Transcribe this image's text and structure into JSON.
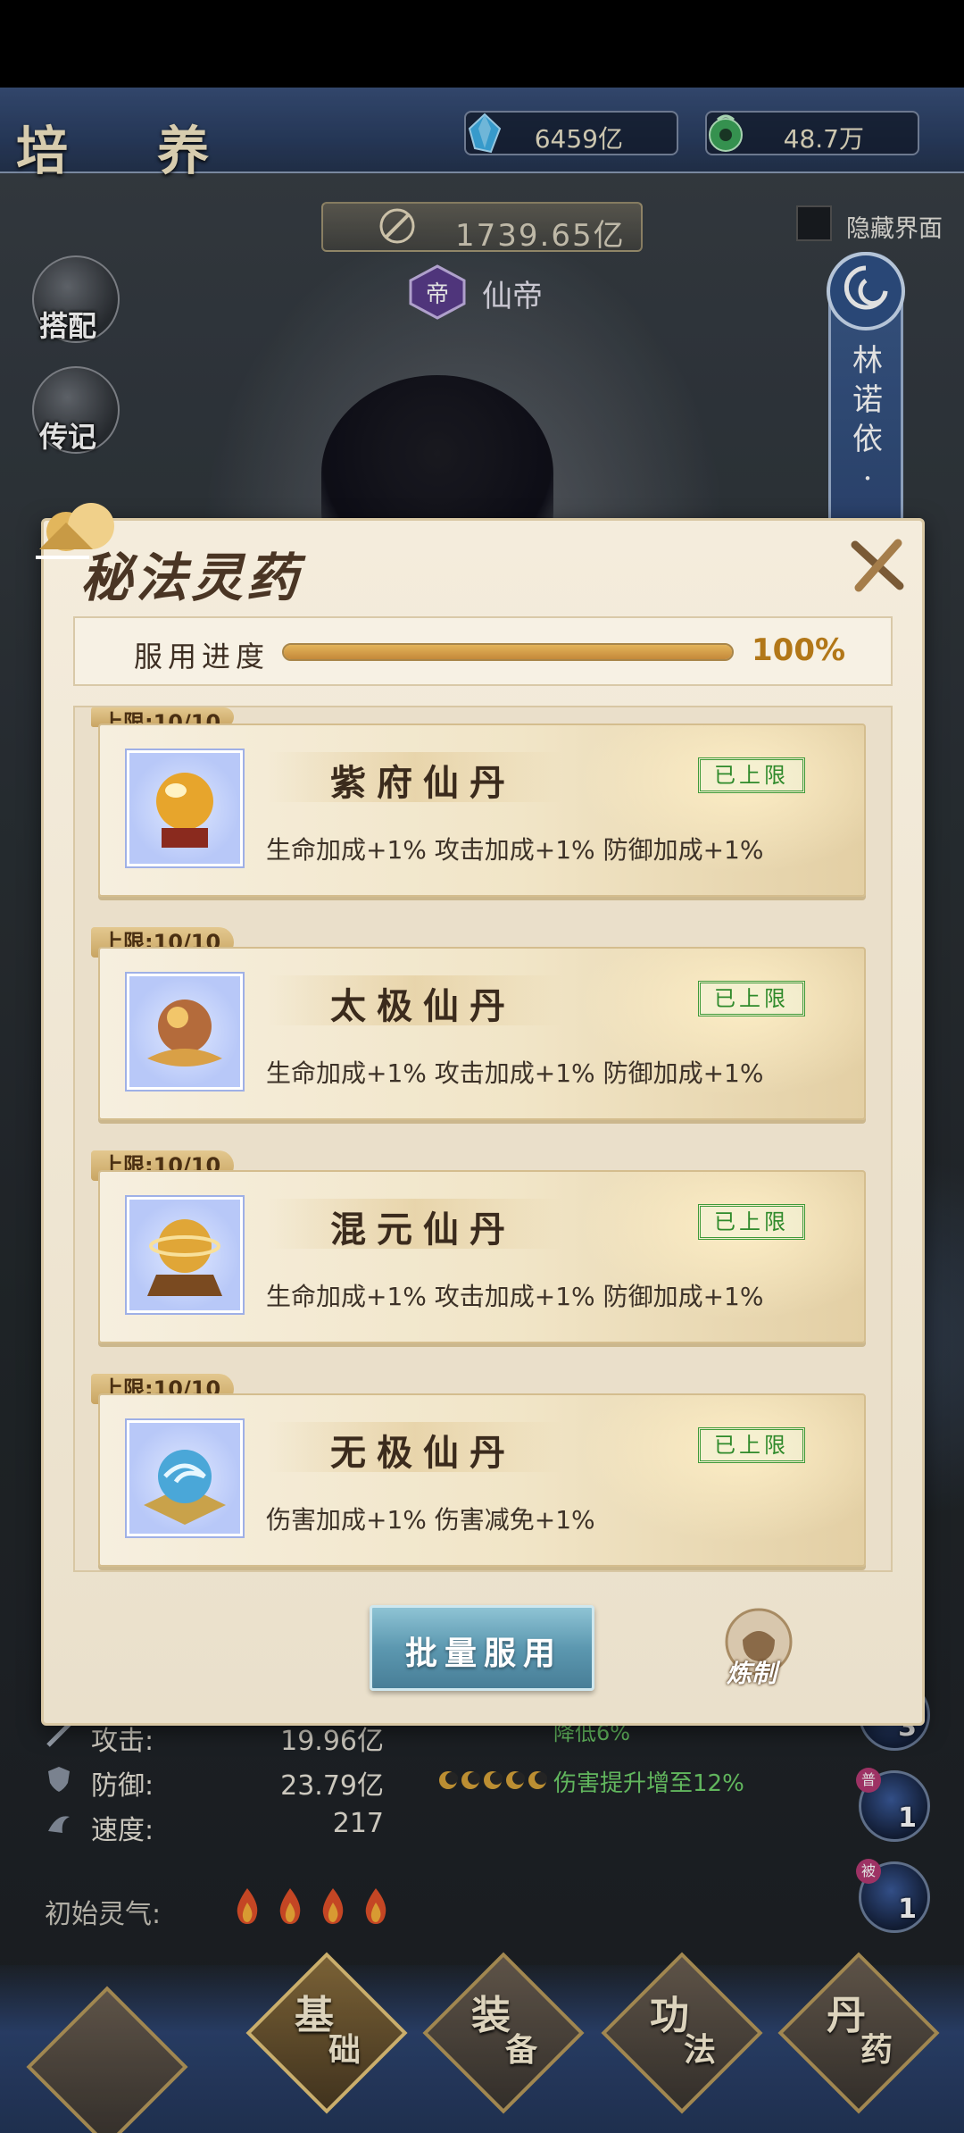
{
  "header": {
    "title": "培 养",
    "gem_amount": "6459亿",
    "coin_amount": "48.7万",
    "combat_power": "1739.65亿",
    "rank": "仙帝",
    "rank_badge": "帝",
    "hide_ui_label": "隐藏界面"
  },
  "side_menu": {
    "outfit": "搭配",
    "legend": "传记"
  },
  "character": {
    "name": "林诺依·"
  },
  "stats": {
    "attack_label": "攻击:",
    "attack_value": "19.96亿",
    "defense_label": "防御:",
    "defense_value": "23.79亿",
    "speed_label": "速度:",
    "speed_value": "217",
    "spirit_label": "初始灵气:",
    "buff_text": "伤害提升增至12%",
    "buff_text2": "降低6%"
  },
  "skills": [
    {
      "count": "3",
      "tag": ""
    },
    {
      "count": "1",
      "tag": "普"
    },
    {
      "count": "1",
      "tag": "被"
    }
  ],
  "nav": [
    {
      "top": "基",
      "bottom": "础"
    },
    {
      "top": "装",
      "bottom": "备"
    },
    {
      "top": "功",
      "bottom": "法"
    },
    {
      "top": "丹",
      "bottom": "药"
    }
  ],
  "modal": {
    "title": "秘法灵药",
    "progress_label": "服用进度",
    "progress_percent": "100%",
    "progress_value": 1.0,
    "items": [
      {
        "cap": "上限:10/10",
        "name": "紫府仙丹",
        "status": "已上限",
        "effect": "生命加成+1% 攻击加成+1% 防御加成+1%",
        "orb_color": "#e7a52c"
      },
      {
        "cap": "上限:10/10",
        "name": "太极仙丹",
        "status": "已上限",
        "effect": "生命加成+1% 攻击加成+1% 防御加成+1%",
        "orb_color": "#b46b3b"
      },
      {
        "cap": "上限:10/10",
        "name": "混元仙丹",
        "status": "已上限",
        "effect": "生命加成+1% 攻击加成+1% 防御加成+1%",
        "orb_color": "#e0a637"
      },
      {
        "cap": "上限:10/10",
        "name": "无极仙丹",
        "status": "已上限",
        "effect": "伤害加成+1% 伤害减免+1%",
        "orb_color": "#4aa7d8"
      }
    ],
    "batch_button": "批量服用",
    "refine_button": "炼制"
  }
}
